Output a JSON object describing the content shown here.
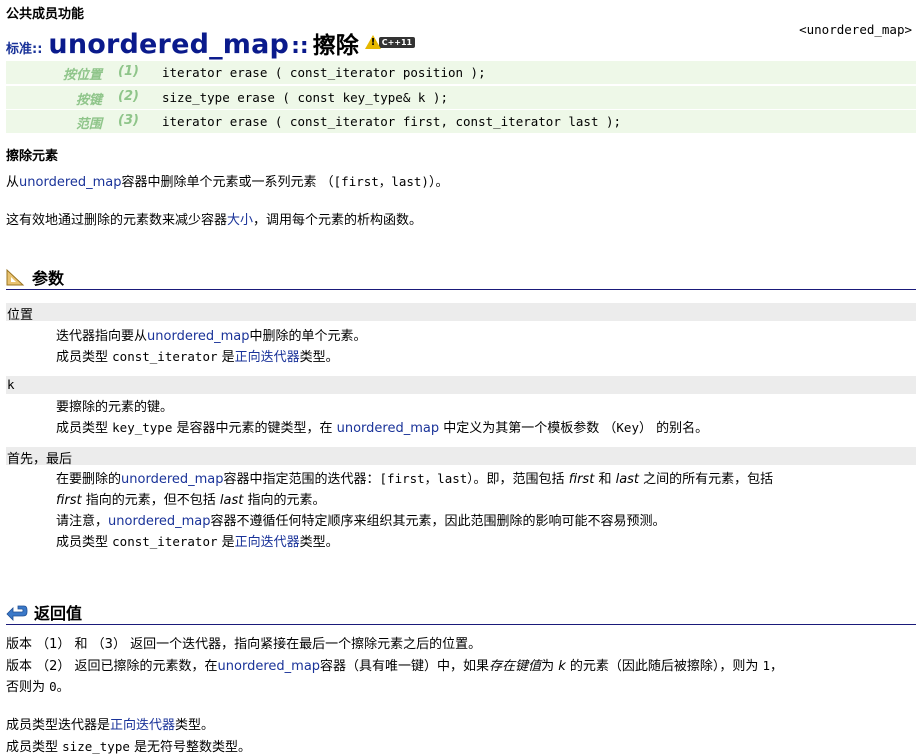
{
  "header": {
    "section_label": "公共成员功能",
    "std_label": "标准::",
    "class_name": "unordered_map",
    "separator": "::",
    "function_name": "擦除",
    "badge_warn": "!",
    "badge_cpp": "C++11",
    "ref": "<unordered_map>"
  },
  "prototypes": [
    {
      "label": "按位置",
      "num": "(1)",
      "code": "iterator erase ( const_iterator position );"
    },
    {
      "label": "按键",
      "num": "(2)",
      "code": "size_type erase ( const key_type& k );"
    },
    {
      "label": "范围",
      "num": "(3)",
      "code": "iterator erase ( const_iterator first, const_iterator last );"
    }
  ],
  "description": {
    "heading": "擦除元素",
    "line1_pre": "从",
    "line1_link": "unordered_map",
    "line1_mid": "容器中删除单个元素或一系列元素 （",
    "line1_code": "[first，last)",
    "line1_post": "）。",
    "line2_pre": "这有效地通过删除的元素数来减少容器",
    "line2_link": "大小",
    "line2_post": "，调用每个元素的析构函数。"
  },
  "params": {
    "heading": "参数",
    "p1": {
      "name": "位置",
      "l1_pre": "迭代器指向要从",
      "l1_link": "unordered_map",
      "l1_post": "中删除的单个元素。",
      "l2_pre": "成员类型 ",
      "l2_code": "const_iterator",
      "l2_mid": " 是",
      "l2_link": "正向迭代器",
      "l2_post": "类型。"
    },
    "p2": {
      "name": "k",
      "l1": "要擦除的元素的键。",
      "l2_pre": "成员类型 ",
      "l2_code": "key_type",
      "l2_mid": " 是容器中元素的键类型，在 ",
      "l2_link": "unordered_map",
      "l2_mid2": " 中定义为其第一个模板参数 （",
      "l2_code2": "Key",
      "l2_post": "） 的别名。"
    },
    "p3": {
      "name": "首先，最后",
      "l1_pre": "在要删除的",
      "l1_link": "unordered_map",
      "l1_mid": "容器中指定范围的迭代器：",
      "l1_code": "[first，last）",
      "l1_mid2": "。即，范围包括 ",
      "l1_em1": "first",
      "l1_mid3": " 和 ",
      "l1_em2": "last",
      "l1_post": " 之间的所有元素，包括",
      "l2_em": "first",
      "l2_mid": " 指向的元素，但不包括 ",
      "l2_em2": "last",
      "l2_post": " 指向的元素。",
      "l3_pre": "请注意，",
      "l3_link": "unordered_map",
      "l3_post": "容器不遵循任何特定顺序来组织其元素，因此范围删除的影响可能不容易预测。",
      "l4_pre": "成员类型 ",
      "l4_code": "const_iterator",
      "l4_mid": " 是",
      "l4_link": "正向迭代器",
      "l4_post": "类型。"
    }
  },
  "return_value": {
    "heading": "返回值",
    "l1": "版本 （1） 和 （3） 返回一个迭代器，指向紧接在最后一个擦除元素之后的位置。",
    "l2_pre": "版本 （2） 返回已擦除的元素数，在",
    "l2_link": "unordered_map",
    "l2_mid": "容器（具有唯一键）中，如果",
    "l2_em": "存在键值",
    "l2_mid2": "为 ",
    "l2_em2": "k",
    "l2_mid3": " 的元素（因此随后被擦除），则为 ",
    "l2_code": "1",
    "l2_post": "，",
    "l3_pre": "否则为 ",
    "l3_code": "0",
    "l3_post": "。",
    "l4_pre": "成员类型迭代器是",
    "l4_link": "正向迭代器",
    "l4_post": "类型。",
    "l5_pre": "成员类型 ",
    "l5_code": "size_type",
    "l5_post": " 是无符号整数类型。"
  }
}
